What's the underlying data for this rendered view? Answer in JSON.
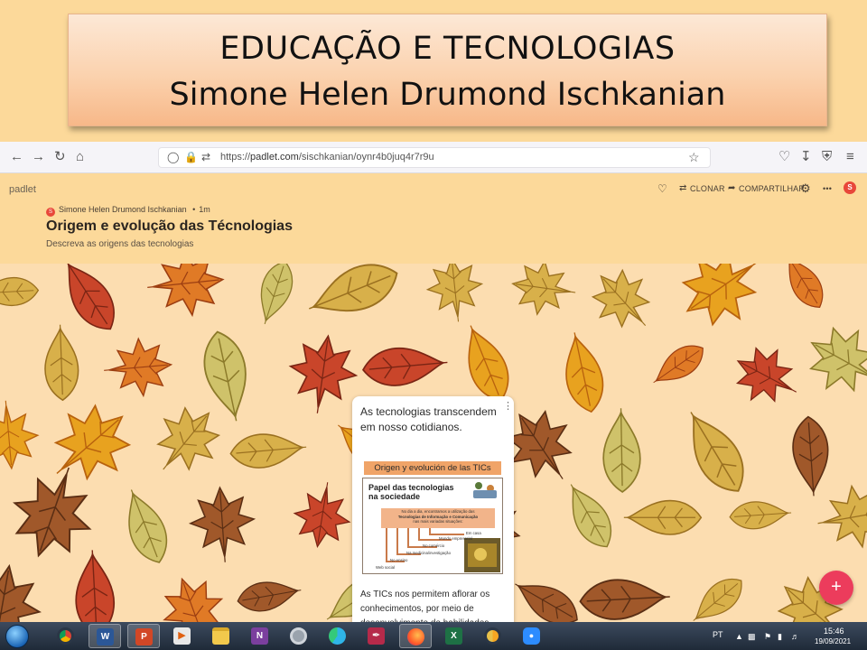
{
  "slide": {
    "title_line1": "EDUCAÇÃO E TECNOLOGIAS",
    "title_line2": "Simone Helen Drumond Ischkanian"
  },
  "browser": {
    "url_scheme": "https://",
    "url_host": "padlet.com",
    "url_path": "/sischkanian/oynr4b0juq4r7r9u"
  },
  "padlet": {
    "logo": "padlet",
    "actions": {
      "clone": "CLONAR",
      "share": "COMPARTILHAR",
      "more": "•••"
    },
    "user_initial": "S",
    "author": "Simone Helen Drumond Ischkanian",
    "time_ago": "1m",
    "board_title": "Origem e evolução das Técnologias",
    "board_subtitle": "Descreva as origens das tecnologias"
  },
  "post": {
    "text_top": "As tecnologias transcendem em nosso cotidianos.",
    "text_bottom": "As TICs nos permitem aflorar os conhecimentos, por meio de desenvolvimento de habilidades.",
    "infographic": {
      "header": "Origen y evolución de las TICs",
      "title": "Papel das tecnologias na sociedade",
      "strip_line1": "No dia a dia, encontramos a utilização das",
      "strip_line2": "Tecnologias de Informação e Comunicação",
      "strip_line3": "nas mais variadas situações:",
      "items": [
        "Em casa",
        "Mundo empresarial",
        "No comércio",
        "Na medicina/investigação",
        "No ensino",
        "Web social"
      ]
    }
  },
  "taskbar": {
    "language": "PT",
    "time": "15:46",
    "date": "19/09/2021"
  },
  "colors": {
    "background": "#fcd99a",
    "accent_orange": "#f0a468",
    "fab": "#ec3c5c",
    "avatar": "#e8473a"
  }
}
